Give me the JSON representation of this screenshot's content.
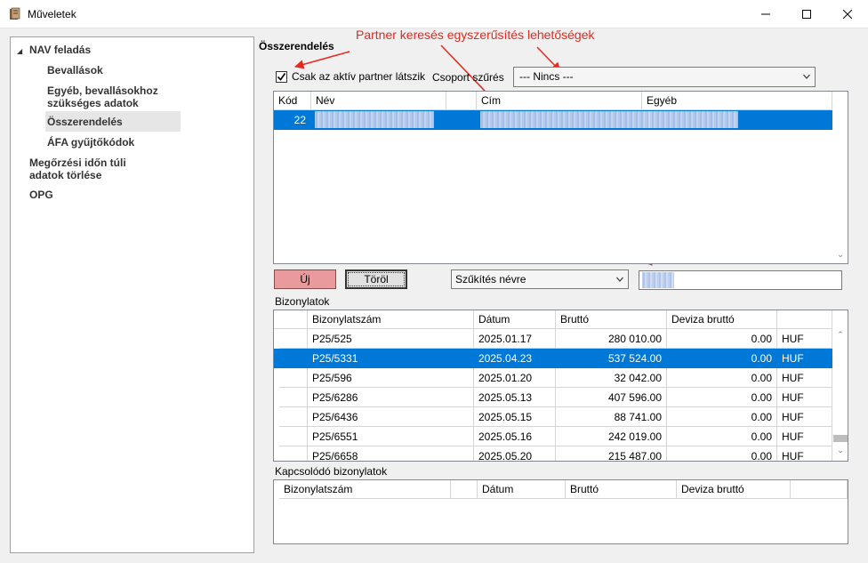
{
  "window": {
    "title": "Műveletek"
  },
  "nav": {
    "items": [
      {
        "label": "NAV feladás"
      },
      {
        "label": "Bevallások"
      },
      {
        "label": "Egyéb, bevallásokhoz szükséges adatok"
      },
      {
        "label": "Összerendelés"
      },
      {
        "label": "ÁFA gyűjtőkódok"
      },
      {
        "label": "Megőrzési időn túli adatok törlése"
      },
      {
        "label": "OPG"
      }
    ]
  },
  "main": {
    "section_title": "Összerendelés",
    "annotation": "Partner keresés egyszerűsítés lehetőségek",
    "active_partner_checkbox": {
      "label": "Csak az aktív partner látszik",
      "checked": true
    },
    "group_filter": {
      "label": "Csoport szűrés",
      "value": "--- Nincs ---"
    },
    "partner_grid": {
      "columns": [
        "Kód",
        "Név",
        "Cím",
        "Egyéb"
      ],
      "rows": [
        {
          "kod": "22"
        }
      ]
    },
    "buttons": {
      "new": "Új",
      "delete": "Töröl"
    },
    "narrow_select": {
      "value": "Szűkítés névre"
    },
    "documents": {
      "label": "Bizonylatok",
      "columns": [
        "Bizonylatszám",
        "Dátum",
        "Bruttó",
        "Deviza bruttó"
      ],
      "rows": [
        {
          "number": "P25/525",
          "date": "2025.01.17",
          "gross": "280 010.00",
          "fx_gross": "0.00",
          "currency": "HUF"
        },
        {
          "number": "P25/5331",
          "date": "2025.04.23",
          "gross": "537 524.00",
          "fx_gross": "0.00",
          "currency": "HUF"
        },
        {
          "number": "P25/596",
          "date": "2025.01.20",
          "gross": "32 042.00",
          "fx_gross": "0.00",
          "currency": "HUF"
        },
        {
          "number": "P25/6286",
          "date": "2025.05.13",
          "gross": "407 596.00",
          "fx_gross": "0.00",
          "currency": "HUF"
        },
        {
          "number": "P25/6436",
          "date": "2025.05.15",
          "gross": "88 741.00",
          "fx_gross": "0.00",
          "currency": "HUF"
        },
        {
          "number": "P25/6551",
          "date": "2025.05.16",
          "gross": "242 019.00",
          "fx_gross": "0.00",
          "currency": "HUF"
        },
        {
          "number": "P25/6658",
          "date": "2025.05.20",
          "gross": "215 487.00",
          "fx_gross": "0.00",
          "currency": "HUF"
        }
      ]
    },
    "related": {
      "label": "Kapcsolódó bizonylatok",
      "columns": [
        "Bizonylatszám",
        "Dátum",
        "Bruttó",
        "Deviza bruttó"
      ]
    }
  },
  "colors": {
    "selection": "#0078d7",
    "annotation": "#e8281e",
    "new_button": "#e89a9c"
  },
  "icons": [
    "app-icon",
    "minimize-icon",
    "maximize-icon",
    "close-icon",
    "expand-arrow-icon",
    "checkmark-icon",
    "chevron-down-icon",
    "scroll-up-icon",
    "scroll-down-icon"
  ]
}
